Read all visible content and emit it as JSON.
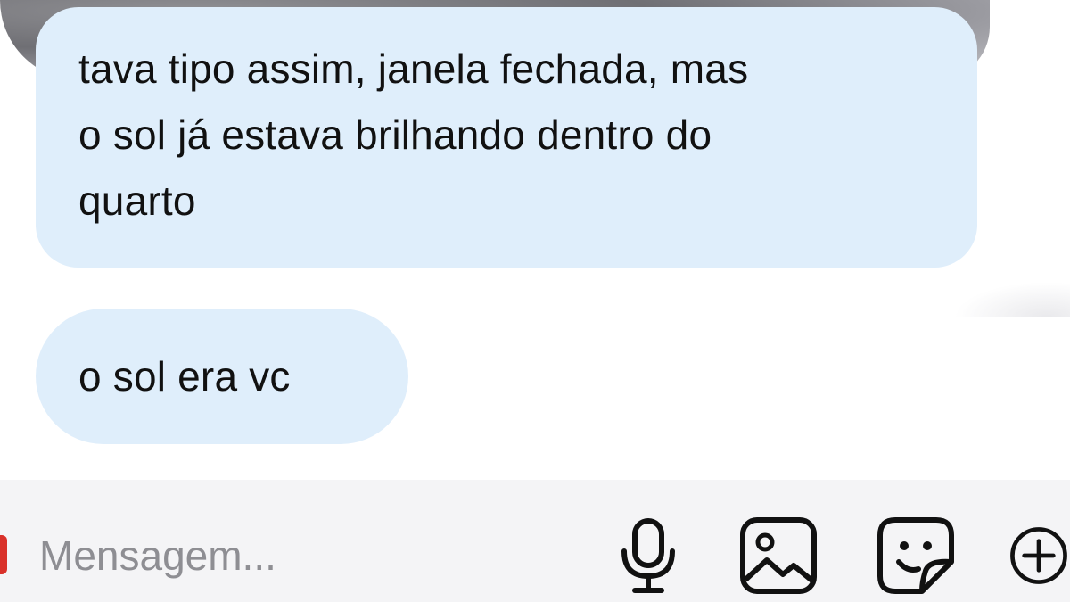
{
  "messages": [
    {
      "lines": [
        "tava tipo assim, janela fechada, mas",
        "o sol já estava brilhando dentro do",
        "quarto"
      ]
    },
    {
      "text": "o sol era vc"
    }
  ],
  "composer": {
    "placeholder": "Mensagem..."
  },
  "icons": {
    "mic": "microphone-icon",
    "image": "image-icon",
    "sticker": "sticker-icon",
    "plus": "plus-circle-icon"
  },
  "colors": {
    "bubble": "#dfeefb",
    "composer_bg": "#f4f4f6",
    "placeholder": "#8e8e93",
    "text": "#111111"
  }
}
